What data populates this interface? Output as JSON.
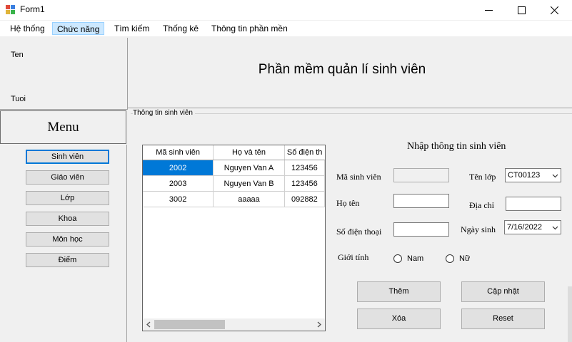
{
  "window": {
    "title": "Form1",
    "min_icon": "minimize-icon",
    "max_icon": "maximize-icon",
    "close_icon": "close-icon"
  },
  "menubar": [
    {
      "label": "Hệ thống"
    },
    {
      "label": "Chức năng",
      "active": true
    },
    {
      "label": "Tìm kiếm"
    },
    {
      "label": "Thống kê"
    },
    {
      "label": "Thông tin phần mền"
    }
  ],
  "user": {
    "ten_label": "Ten",
    "tuoi_label": "Tuoi"
  },
  "menu_title": "Menu",
  "sidebar": [
    {
      "label": "Sinh viên"
    },
    {
      "label": "Giáo viên"
    },
    {
      "label": "Lớp"
    },
    {
      "label": "Khoa"
    },
    {
      "label": "Môn học"
    },
    {
      "label": "Điểm"
    }
  ],
  "header_title": "Phần mềm quản lí sinh viên",
  "group_label": "Thông tin sinh viên",
  "grid": {
    "columns": [
      "Mã sinh viên",
      "Họ và tên",
      "Số điện th"
    ],
    "rows": [
      [
        "2002",
        "Nguyen Van A",
        "123456"
      ],
      [
        "2003",
        "Nguyen Van B",
        "123456"
      ],
      [
        "3002",
        "aaaaa",
        "092882"
      ]
    ]
  },
  "form": {
    "title": "Nhập thông tin sinh viên",
    "ma_sv_label": "Mã sinh viên",
    "ho_ten_label": "Họ tên",
    "sdt_label": "Số điện thoại",
    "gioi_tinh_label": "Giới tính",
    "ten_lop_label": "Tên lớp",
    "ten_lop_value": "CT00123",
    "dia_chi_label": "Địa chỉ",
    "ngay_sinh_label": "Ngày sinh",
    "ngay_sinh_value": "7/16/2022",
    "nam_label": "Nam",
    "nu_label": "Nữ"
  },
  "buttons": {
    "them": "Thêm",
    "cap_nhat": "Cập nhật",
    "xoa": "Xóa",
    "reset": "Reset"
  },
  "colors": {
    "accent": "#0078d7",
    "selection": "#0078d7",
    "menu_active": "#cce8ff"
  }
}
